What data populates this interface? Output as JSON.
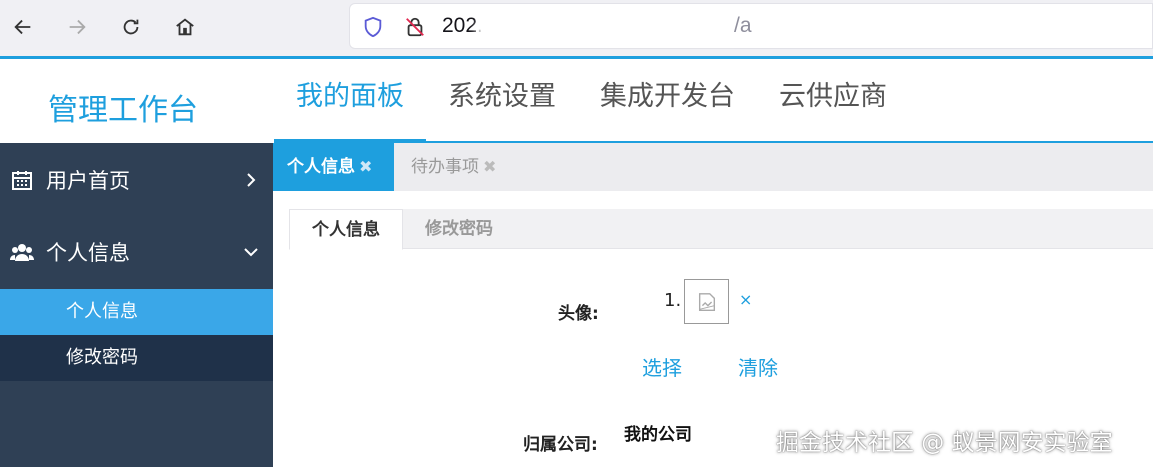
{
  "browser": {
    "url_visible_prefix": "202.",
    "url_visible_suffix": "/a",
    "icons": [
      "back-arrow-icon",
      "forward-arrow-icon",
      "reload-icon",
      "home-icon",
      "shield-icon",
      "insecure-lock-icon"
    ]
  },
  "header": {
    "logo": "管理工作台",
    "nav": [
      {
        "label": "我的面板",
        "active": true
      },
      {
        "label": "系统设置",
        "active": false
      },
      {
        "label": "集成开发台",
        "active": false
      },
      {
        "label": "云供应商",
        "active": false
      }
    ]
  },
  "sidebar": {
    "items": [
      {
        "label": "用户首页",
        "icon": "calendar-icon",
        "chevron": "chevron-right-icon"
      },
      {
        "label": "个人信息",
        "icon": "users-icon",
        "chevron": "chevron-down-icon"
      }
    ],
    "sub_items": [
      {
        "label": "个人信息",
        "active": true
      },
      {
        "label": "修改密码",
        "active": false
      }
    ]
  },
  "tabs": [
    {
      "label": "个人信息",
      "close": "✖",
      "active": true
    },
    {
      "label": "待办事项",
      "close": "✖",
      "active": false
    }
  ],
  "subtabs": [
    {
      "label": "个人信息",
      "active": true
    },
    {
      "label": "修改密码",
      "active": false
    }
  ],
  "form": {
    "avatar_label": "头像:",
    "avatar_index": "1.",
    "avatar_remove": "×",
    "select_button": "选择",
    "clear_button": "清除",
    "company_label": "归属公司:",
    "company_value": "我的公司"
  },
  "watermark": "掘金技术社区 @ 蚁景网安实验室",
  "colors": {
    "accent": "#1e9fde",
    "sidebar_bg": "#2f4055",
    "sidebar_active": "#3aa7e8",
    "sidebar_sub_dark": "#1f3149"
  }
}
